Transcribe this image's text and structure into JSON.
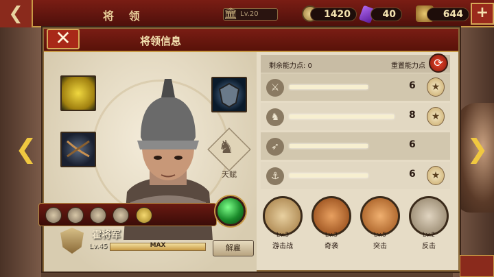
{
  "topbar": {
    "back_icon": "back-arrow-icon",
    "title": "将 领",
    "level_text": "Lv.20",
    "silver": "1420",
    "gems": "40",
    "food": "644",
    "plus": "+"
  },
  "panel": {
    "title": "将领信息",
    "close": "✕"
  },
  "general": {
    "name": "霍将军",
    "level": "Lv.45",
    "exp_label": "MAX",
    "exp_progress": 1.0,
    "dismiss": "解雇",
    "talent_label": "天赋"
  },
  "stats": {
    "remaining_label": "剩余能力点: 0",
    "reset_label": "重置能力点",
    "rows": [
      {
        "icon": "sword-icon",
        "value": "6",
        "progress": 0.6,
        "has_star": true
      },
      {
        "icon": "horse-icon",
        "value": "8",
        "progress": 0.8,
        "has_star": true
      },
      {
        "icon": "bow-icon",
        "value": "6",
        "progress": 0.6,
        "has_star": false
      },
      {
        "icon": "anchor-icon",
        "value": "6",
        "progress": 0.6,
        "has_star": true
      }
    ]
  },
  "skills": [
    {
      "level": "Lv.3",
      "name": "游击战"
    },
    {
      "level": "Lv.3",
      "name": "奇袭"
    },
    {
      "level": "Lv.5",
      "name": "突击"
    },
    {
      "level": "Lv.2",
      "name": "反击"
    }
  ],
  "colors": {
    "accent_red": "#7a1d14",
    "gold": "#c89a45",
    "gem_green": "#1a8a2a"
  }
}
